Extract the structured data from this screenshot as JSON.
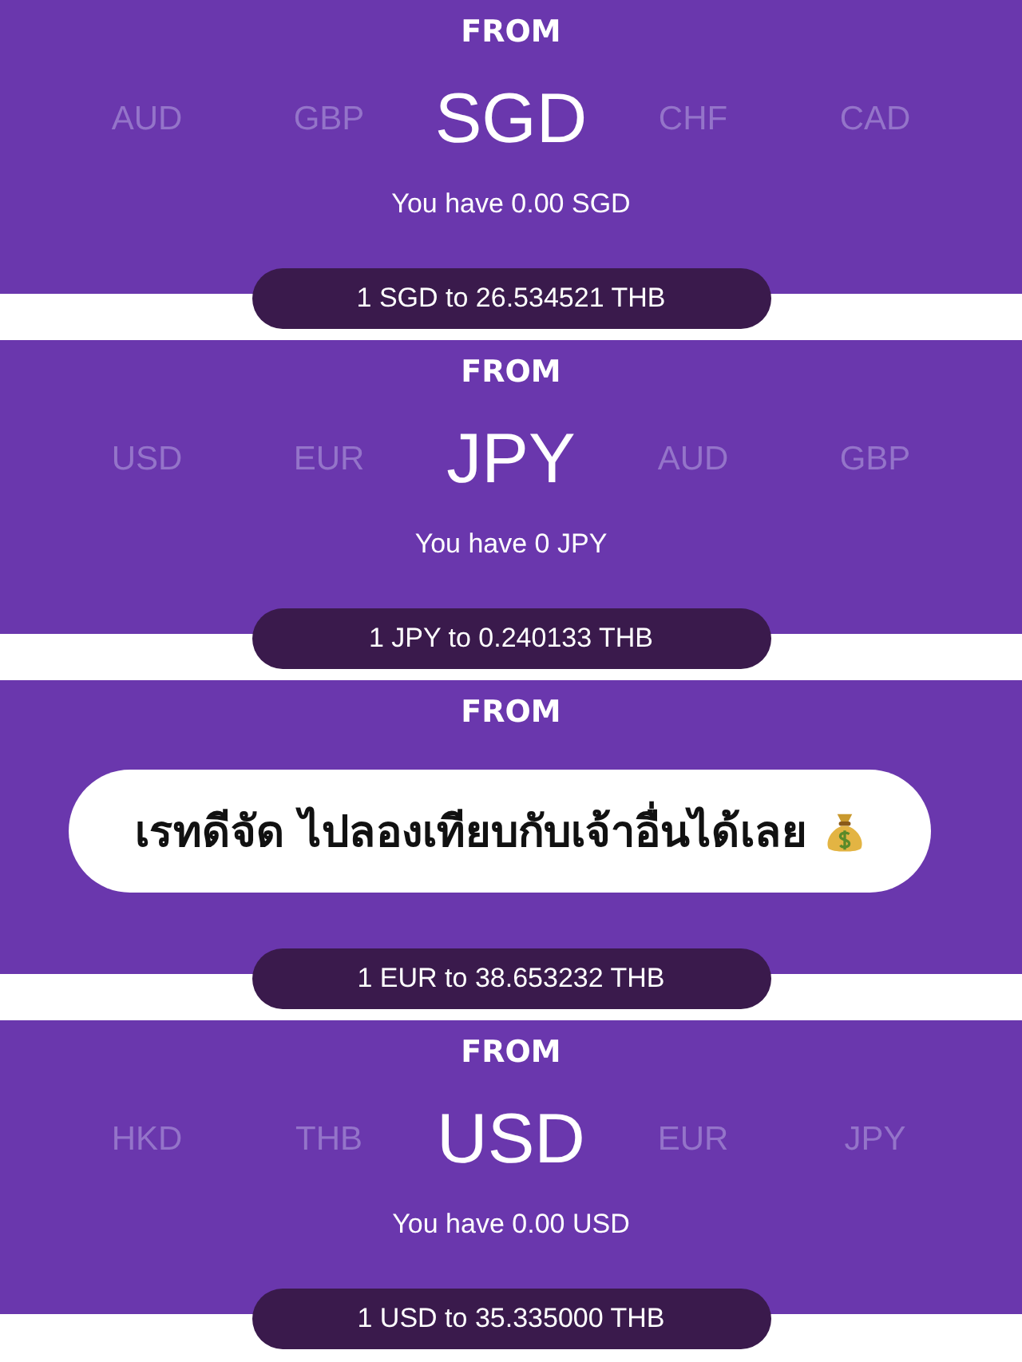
{
  "panels": [
    {
      "label": "FROM",
      "currencies": [
        {
          "code": "AUD",
          "selected": false
        },
        {
          "code": "GBP",
          "selected": false
        },
        {
          "code": "SGD",
          "selected": true
        },
        {
          "code": "CHF",
          "selected": false
        },
        {
          "code": "CAD",
          "selected": false
        }
      ],
      "balance": "You have 0.00 SGD",
      "rate": "1 SGD to 26.534521 THB"
    },
    {
      "label": "FROM",
      "currencies": [
        {
          "code": "USD",
          "selected": false
        },
        {
          "code": "EUR",
          "selected": false
        },
        {
          "code": "JPY",
          "selected": true
        },
        {
          "code": "AUD",
          "selected": false
        },
        {
          "code": "GBP",
          "selected": false
        }
      ],
      "balance": "You have 0 JPY",
      "rate": "1 JPY to 0.240133 THB"
    },
    {
      "label": "FROM",
      "rate": "1 EUR to 38.653232 THB"
    },
    {
      "label": "FROM",
      "currencies": [
        {
          "code": "HKD",
          "selected": false
        },
        {
          "code": "THB",
          "selected": false
        },
        {
          "code": "USD",
          "selected": true
        },
        {
          "code": "EUR",
          "selected": false
        },
        {
          "code": "JPY",
          "selected": false
        }
      ],
      "balance": "You have 0.00 USD",
      "rate": "1 USD to 35.335000 THB"
    }
  ],
  "caption": "เรทดีจัด ไปลองเทียบกับเจ้าอื่นได้เลย"
}
